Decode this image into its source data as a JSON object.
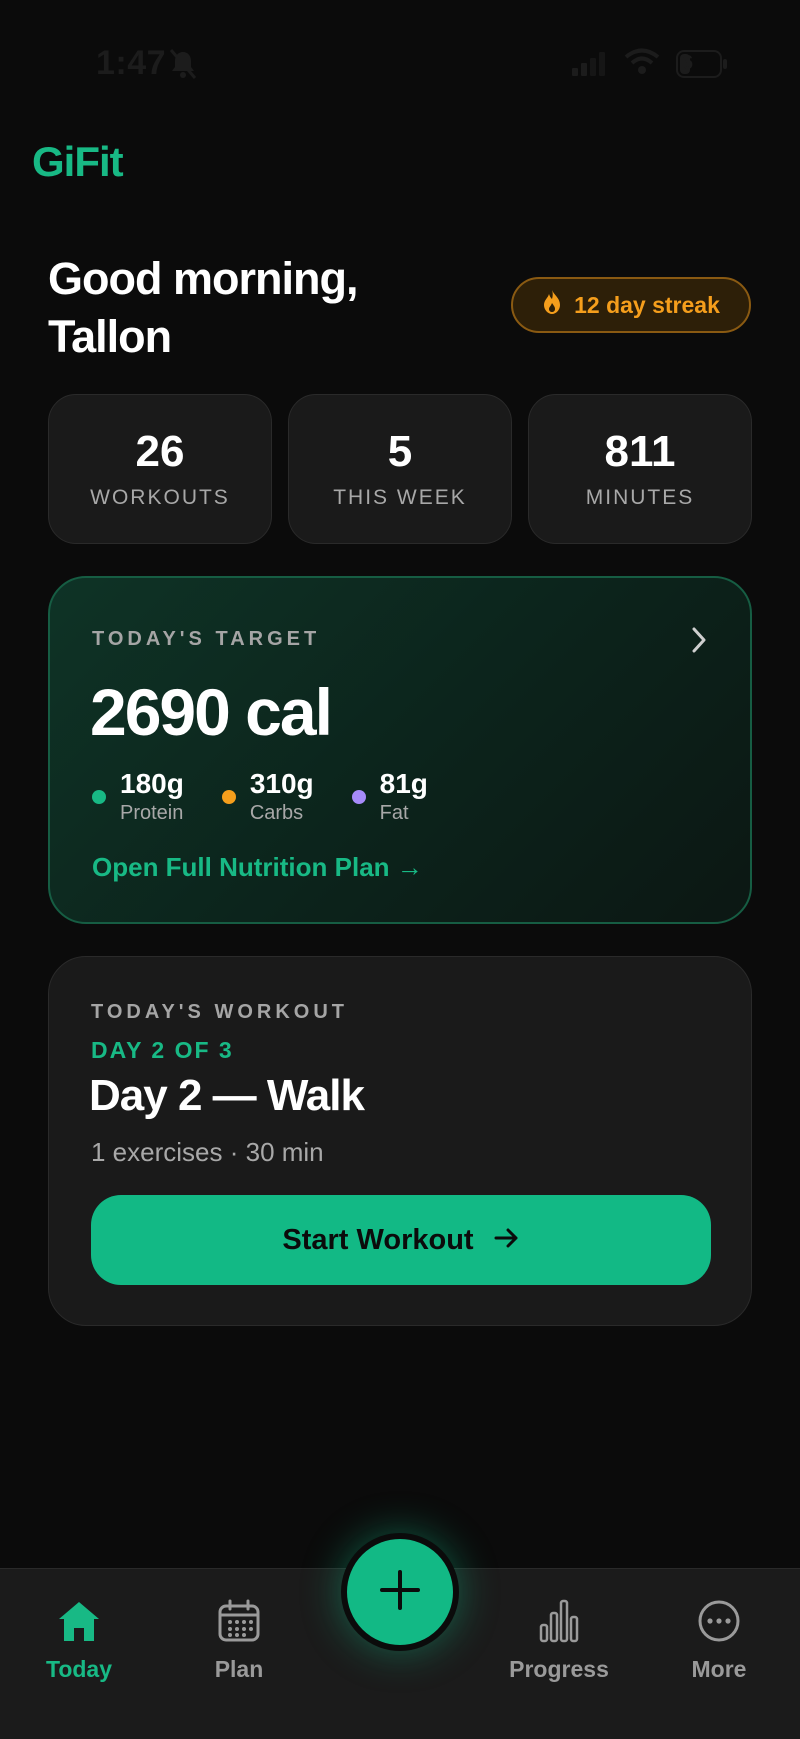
{
  "status_bar": {
    "time": "1:47",
    "battery": "6"
  },
  "app": {
    "logo": "GiFit"
  },
  "greeting": {
    "line1": "Good morning,",
    "line2": "Tallon"
  },
  "streak": {
    "label": "12 day streak",
    "icon": "flame-icon",
    "color": "#f59e1c"
  },
  "stats": [
    {
      "value": "26",
      "label": "WORKOUTS"
    },
    {
      "value": "5",
      "label": "THIS WEEK"
    },
    {
      "value": "811",
      "label": "MINUTES"
    }
  ],
  "target": {
    "label": "TODAY'S TARGET",
    "calories": "2690 cal",
    "macros": [
      {
        "value": "180g",
        "name": "Protein",
        "color": "#18b985"
      },
      {
        "value": "310g",
        "name": "Carbs",
        "color": "#f59e1c"
      },
      {
        "value": "81g",
        "name": "Fat",
        "color": "#a78bfa"
      }
    ],
    "link": "Open Full Nutrition Plan →"
  },
  "workout": {
    "label": "TODAY'S WORKOUT",
    "day": "DAY 2 OF 3",
    "title": "Day 2 — Walk",
    "meta": "1 exercises · 30 min",
    "button": "Start Workout"
  },
  "tabs": [
    {
      "label": "Today",
      "icon": "home-icon",
      "active": true
    },
    {
      "label": "Plan",
      "icon": "calendar-icon",
      "active": false
    },
    {
      "label": "Progress",
      "icon": "bar-chart-icon",
      "active": false
    },
    {
      "label": "More",
      "icon": "more-icon",
      "active": false
    }
  ],
  "colors": {
    "accent": "#18b985",
    "background": "#0b0b0b",
    "card": "#1a1a1a"
  }
}
